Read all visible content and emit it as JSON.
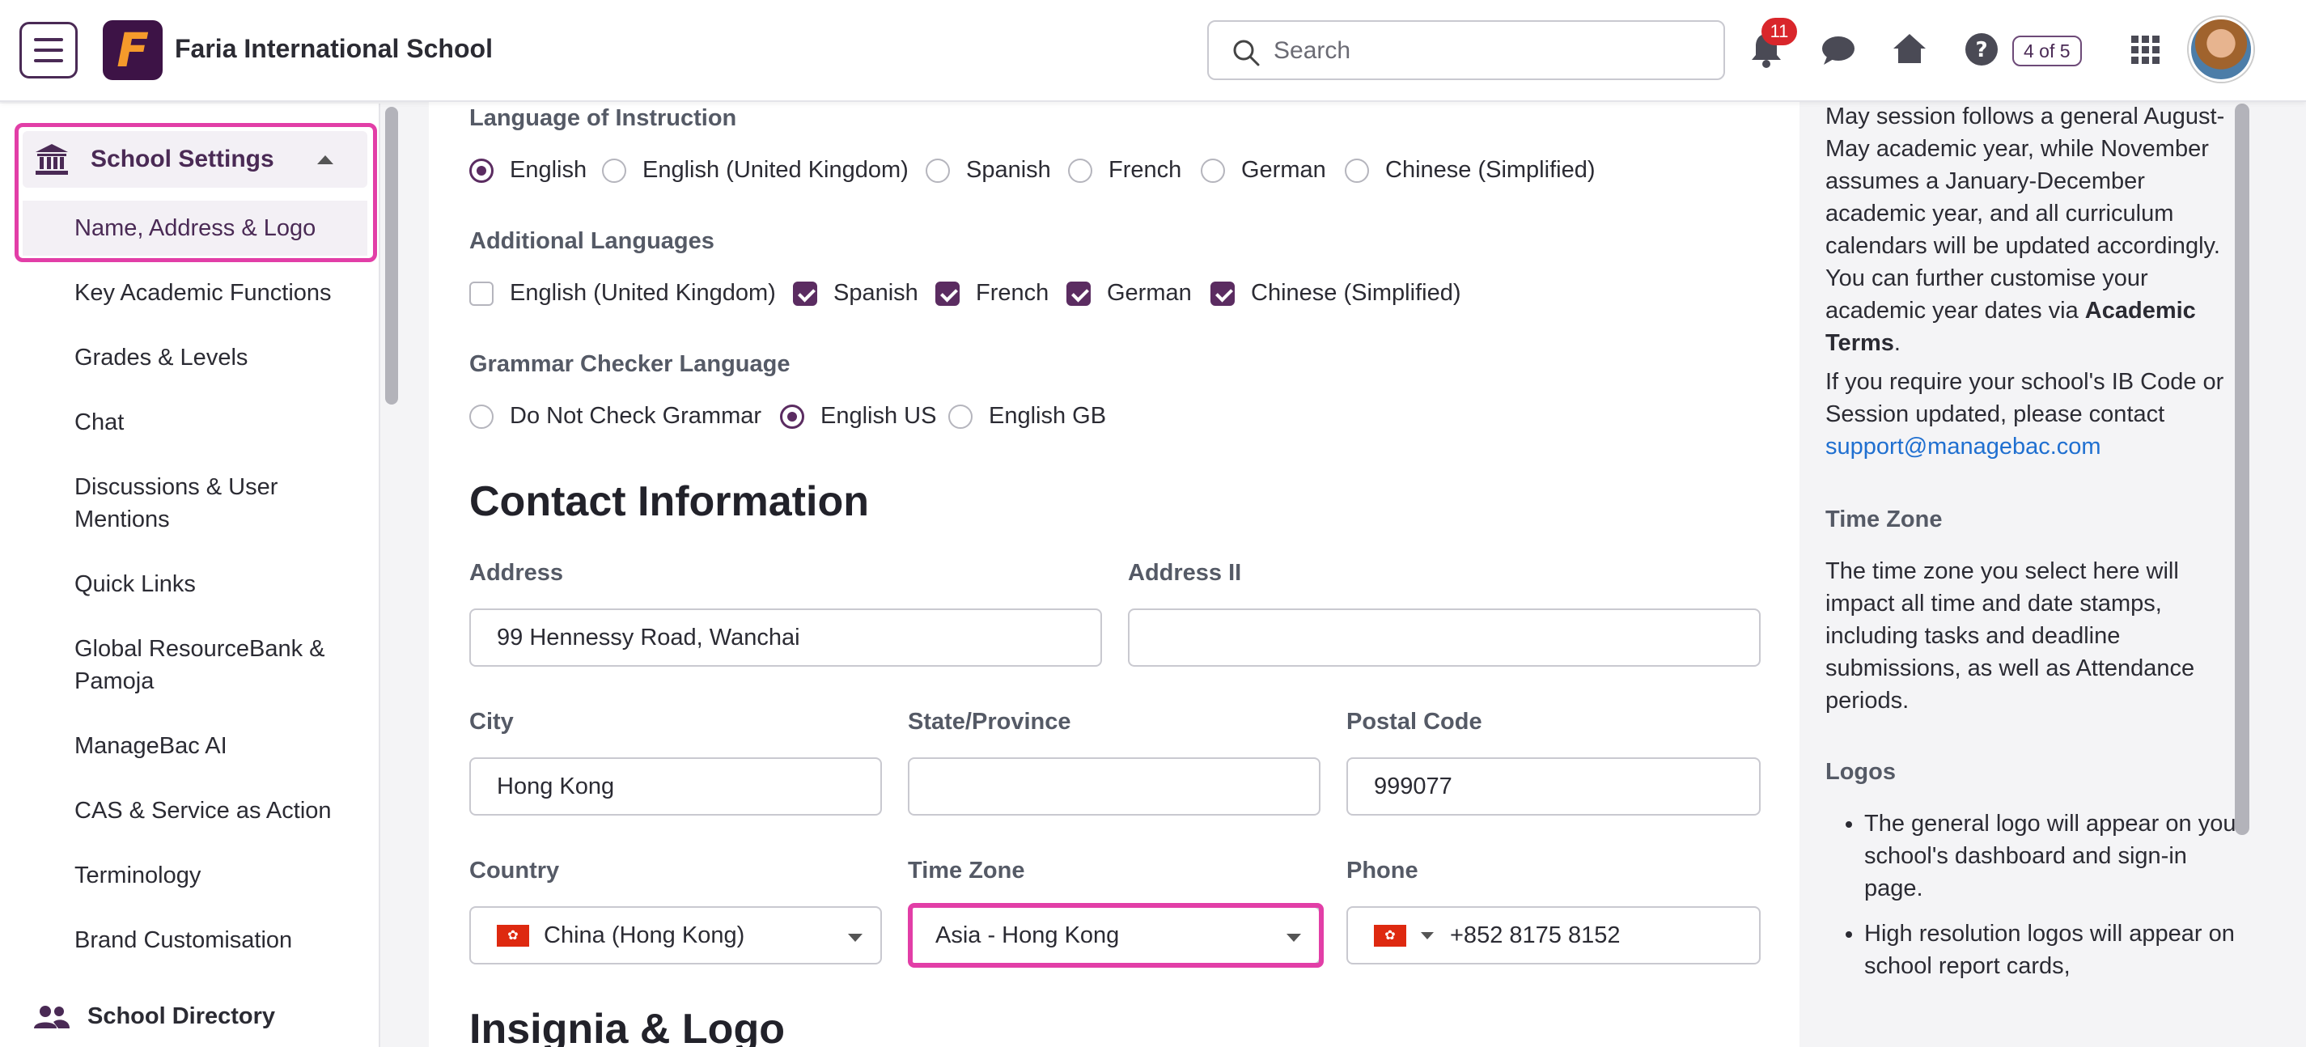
{
  "topbar": {
    "school_name": "Faria International School",
    "logo_letter": "F",
    "search_placeholder": "Search",
    "notification_count": "11",
    "page_counter": "4 of 5"
  },
  "sidebar": {
    "section_label": "School Settings",
    "active_item": "Name, Address & Logo",
    "items": [
      "Key Academic Functions",
      "Grades & Levels",
      "Chat",
      "Discussions & User Mentions",
      "Quick Links",
      "Global ResourceBank & Pamoja",
      "ManageBac AI",
      "CAS & Service as Action",
      "Terminology",
      "Brand Customisation"
    ],
    "directory_label": "School Directory"
  },
  "main": {
    "language_of_instruction": {
      "label": "Language of Instruction",
      "options": [
        "English",
        "English (United Kingdom)",
        "Spanish",
        "French",
        "German",
        "Chinese (Simplified)"
      ],
      "selected": "English"
    },
    "additional_languages": {
      "label": "Additional Languages",
      "options": [
        "English (United Kingdom)",
        "Spanish",
        "French",
        "German",
        "Chinese (Simplified)"
      ],
      "checked": [
        "Spanish",
        "French",
        "German",
        "Chinese (Simplified)"
      ]
    },
    "grammar_checker": {
      "label": "Grammar Checker Language",
      "options": [
        "Do Not Check Grammar",
        "English US",
        "English GB"
      ],
      "selected": "English US"
    },
    "contact_title": "Contact Information",
    "address": {
      "label": "Address",
      "value": "99 Hennessy Road, Wanchai"
    },
    "address2": {
      "label": "Address II",
      "value": ""
    },
    "city": {
      "label": "City",
      "value": "Hong Kong"
    },
    "state": {
      "label": "State/Province",
      "value": ""
    },
    "postal": {
      "label": "Postal Code",
      "value": "999077"
    },
    "country": {
      "label": "Country",
      "value": "China (Hong Kong)"
    },
    "timezone": {
      "label": "Time Zone",
      "value": "Asia - Hong Kong"
    },
    "phone": {
      "label": "Phone",
      "value": "+852 8175 8152"
    },
    "insignia_title": "Insignia & Logo"
  },
  "help": {
    "p1_a": "May session follows a general August-May academic year, while November assumes a January-December academic year, and all curriculum calendars will be updated accordingly. You can further customise your academic year dates via ",
    "p1_bold": "Academic Terms",
    "p1_end": ".",
    "p2": "If you require your school's IB Code or Session updated, please contact",
    "support_email": "support@managebac.com",
    "timezone_heading": "Time Zone",
    "timezone_text": "The time zone you select here will impact all time and date stamps, including tasks and deadline submissions, as well as Attendance periods.",
    "logos_heading": "Logos",
    "logos_bullets": [
      "The general logo will appear on your school's dashboard and sign-in page.",
      "High resolution logos will appear on school report cards,"
    ]
  },
  "colors": {
    "brand": "#4a2a55",
    "highlight": "#e23ea7",
    "notification": "#d9262b",
    "link": "#1f6fd0"
  }
}
